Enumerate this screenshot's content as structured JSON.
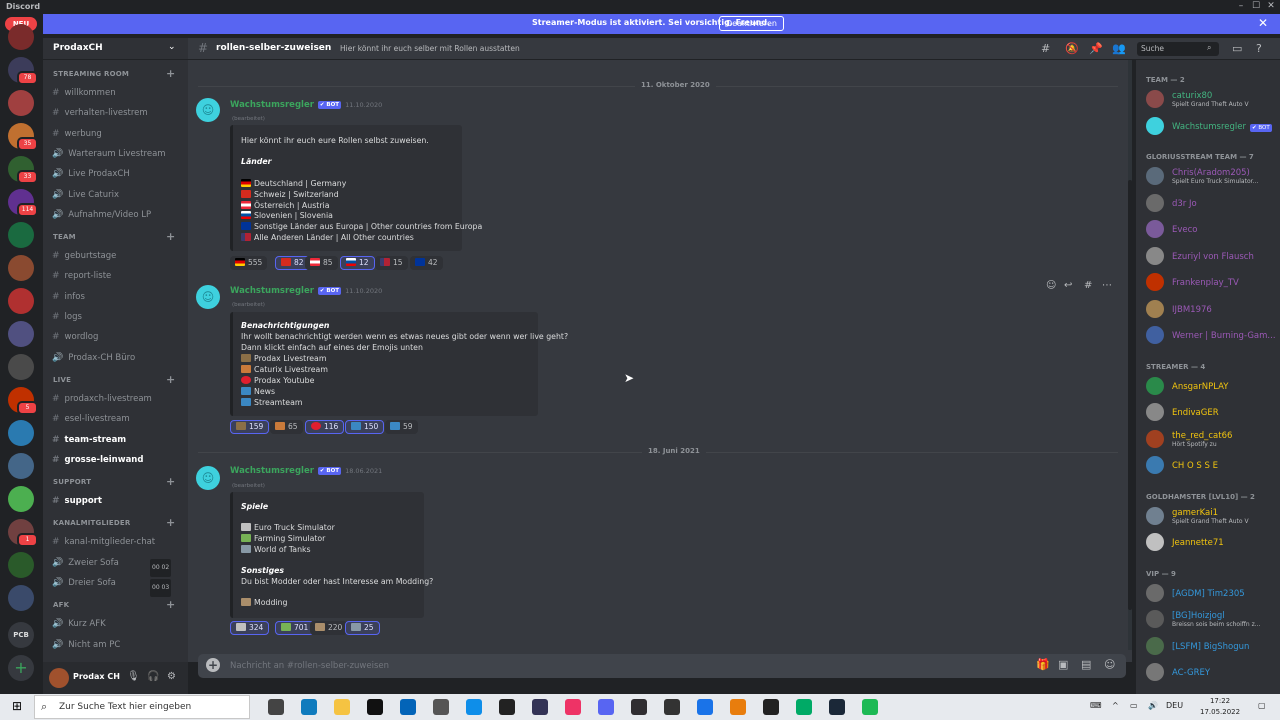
{
  "app": {
    "title": "Discord"
  },
  "banner": {
    "text": "Streamer-Modus ist aktiviert. Sei vorsichtig, Freund.",
    "button": "Deaktivieren",
    "color": "#5865f2"
  },
  "servers": {
    "new_label": "NEU",
    "badges": [
      "78",
      "35",
      "33",
      "114",
      "1",
      "5",
      "1"
    ],
    "pcb_label": "PCB"
  },
  "guild": {
    "name": "ProdaxCH"
  },
  "categories": [
    {
      "name": "STREAMING ROOM",
      "channels": [
        "willkommen",
        "verhalten-livestrem",
        "werbung",
        "Warteraum Livestream",
        "Live ProdaxCH",
        "Live Caturix",
        "Aufnahme/Video LP"
      ]
    },
    {
      "name": "TEAM",
      "channels": [
        "geburtstage",
        "report-liste",
        "infos",
        "logs",
        "wordlog",
        "Prodax-CH Büro"
      ]
    },
    {
      "name": "LIVE",
      "channels": [
        "prodaxch-livestream",
        "esel-livestream",
        "team-stream",
        "grosse-leinwand"
      ]
    },
    {
      "name": "SUPPORT",
      "channels": [
        "support"
      ]
    },
    {
      "name": "KANALMITGLIEDER",
      "channels": [
        "kanal-mitglieder-chat",
        "Zweier Sofa",
        "Dreier Sofa"
      ],
      "voice_counts": [
        [
          "00",
          "02"
        ],
        [
          "00",
          "03"
        ]
      ]
    },
    {
      "name": "AFK",
      "channels": [
        "Kurz AFK",
        "Nicht am PC"
      ]
    }
  ],
  "user": {
    "name": "Prodax CH"
  },
  "header": {
    "channel": "rollen-selber-zuweisen",
    "topic": "Hier könnt ihr euch selber mit Rollen ausstatten",
    "search_placeholder": "Suche"
  },
  "chat": {
    "dividers": [
      "11. Oktober 2020",
      "18. Juni 2021"
    ],
    "edited": "(bearbeitet)",
    "bot_tag": "✔ BOT",
    "messages": [
      {
        "author": "Wachstumsregler",
        "date": "11.10.2020",
        "lines": [
          "Hier könnt ihr euch eure Rollen selbst zuweisen.",
          "Länder",
          "Deutschland | Germany",
          "Schweiz | Switzerland",
          "Österreich | Austria",
          "Slovenien | Slovenia",
          "Sonstige Länder aus Europa | Other countries from Europa",
          "Alle Anderen Länder | All Other countries"
        ],
        "reactions": [
          "555",
          "82",
          "85",
          "12",
          "15",
          "42"
        ]
      },
      {
        "author": "Wachstumsregler",
        "date": "11.10.2020",
        "lines": [
          "Benachrichtigungen",
          "Ihr wollt benachrichtigt werden wenn es etwas neues gibt oder wenn wer live geht?",
          "Dann klickt einfach auf eines der Emojis unten",
          "Prodax Livestream",
          "Caturix Livestream",
          "Prodax Youtube",
          "News",
          "Streamteam"
        ],
        "reactions": [
          "159",
          "65",
          "116",
          "150",
          "59"
        ]
      },
      {
        "author": "Wachstumsregler",
        "date": "18.06.2021",
        "lines": [
          "Spiele",
          "Euro Truck Simulator",
          "Farming Simulator",
          "World of Tanks",
          "Sonstiges",
          "Du bist Modder oder hast Interesse am Modding?",
          "Modding"
        ],
        "reactions": [
          "324",
          "701",
          "220",
          "25"
        ]
      }
    ],
    "composer_placeholder": "Nachricht an #rollen-selber-zuweisen"
  },
  "members": {
    "groups": [
      {
        "name": "TEAM — 2",
        "items": [
          {
            "name": "caturix80",
            "status": "Spielt Grand Theft Auto V",
            "color": "#43b581"
          },
          {
            "name": "Wachstumsregler",
            "status": "",
            "color": "#43b581"
          }
        ]
      },
      {
        "name": "GLORIUSSTREAM TEAM — 7",
        "items": [
          {
            "name": "Chris(Aradom205)",
            "status": "Spielt Euro Truck Simulator...",
            "color": "#9b59b6"
          },
          {
            "name": "d3r Jo",
            "status": "",
            "color": "#9b59b6"
          },
          {
            "name": "Eveco",
            "status": "",
            "color": "#9b59b6"
          },
          {
            "name": "Ezuriyl von Flausch",
            "status": "",
            "color": "#9b59b6"
          },
          {
            "name": "Frankenplay_TV",
            "status": "",
            "color": "#9b59b6"
          },
          {
            "name": "IJBM1976",
            "status": "",
            "color": "#9b59b6"
          },
          {
            "name": "Werner | Burning-Gam...",
            "status": "",
            "color": "#9b59b6"
          }
        ]
      },
      {
        "name": "STREAMER — 4",
        "items": [
          {
            "name": "AnsgarNPLAY",
            "status": "",
            "color": "#f1c40f"
          },
          {
            "name": "EndivaGER",
            "status": "",
            "color": "#f1c40f"
          },
          {
            "name": "the_red_cat66",
            "status": "Hört Spotify zu",
            "color": "#f1c40f"
          },
          {
            "name": "CH O S S E",
            "status": "",
            "color": "#f1c40f"
          }
        ]
      },
      {
        "name": "GOLDHAMSTER [LVL10] — 2",
        "items": [
          {
            "name": "gamerKai1",
            "status": "Spielt Grand Theft Auto V",
            "color": "#f1c40f"
          },
          {
            "name": "Jeannette71",
            "status": "",
            "color": "#f1c40f"
          }
        ]
      },
      {
        "name": "VIP — 9",
        "items": [
          {
            "name": "[AGDM] Tim2305",
            "status": "",
            "color": "#3498db"
          },
          {
            "name": "[BG]Hoizjogl",
            "status": "Breissn sois beim schoiffn z...",
            "color": "#3498db"
          },
          {
            "name": "[LSFM] BigShogun",
            "status": "",
            "color": "#3498db"
          },
          {
            "name": "AC-GREY",
            "status": "",
            "color": "#3498db"
          }
        ]
      }
    ]
  },
  "taskbar": {
    "search_placeholder": "Zur Suche Text hier eingeben",
    "lang": "DEU",
    "time": "17:22",
    "date": "17.05.2022"
  }
}
